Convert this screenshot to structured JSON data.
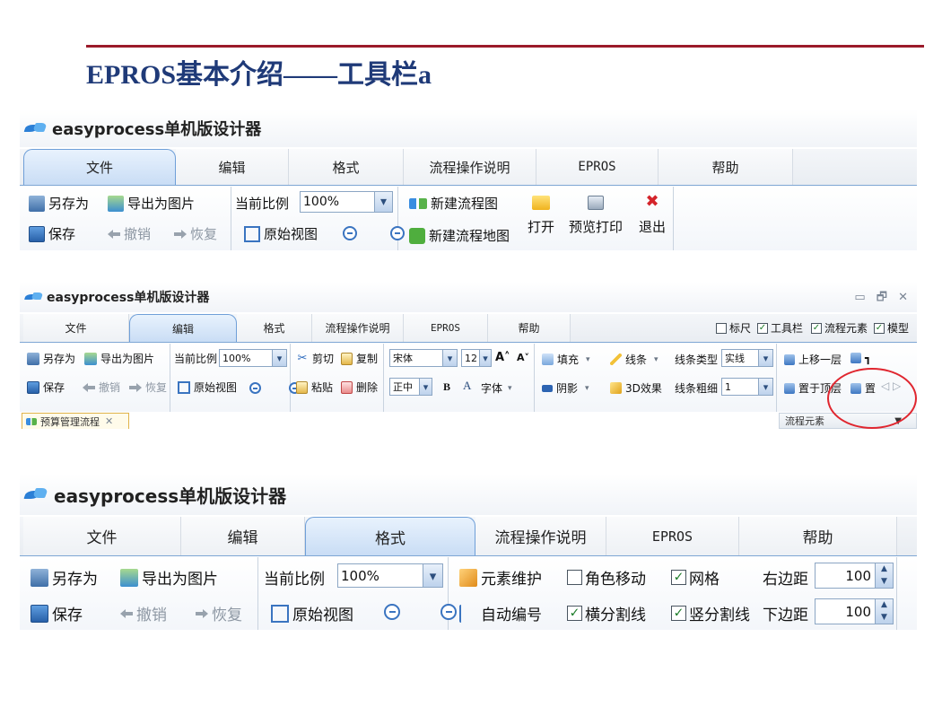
{
  "slide": {
    "title": "EPROS基本介绍——工具栏a",
    "accent_color": "#9b1b2a",
    "title_color": "#1f3a78"
  },
  "window": {
    "title": "easyprocess单机版设计器",
    "logo_icon": "easyprocess-logo-icon"
  },
  "tabs": [
    "文件",
    "编辑",
    "格式",
    "流程操作说明",
    "EPROS",
    "帮助"
  ],
  "file_ribbon": {
    "save_as": "另存为",
    "export_image": "导出为图片",
    "save": "保存",
    "undo": "撤销",
    "redo": "恢复",
    "zoom_label": "当前比例",
    "zoom_value": "100%",
    "original_view": "原始视图",
    "new_flow": "新建流程图",
    "new_flow_map": "新建流程地图",
    "open": "打开",
    "print_preview": "预览打印",
    "exit": "退出"
  },
  "edit_ribbon": {
    "window_controls": "▭ 🗗 ✕",
    "toggles": [
      {
        "label": "标尺",
        "checked": false
      },
      {
        "label": "工具栏",
        "checked": true
      },
      {
        "label": "流程元素",
        "checked": true
      },
      {
        "label": "模型",
        "checked": true
      }
    ],
    "save_as": "另存为",
    "export_image": "导出为图片",
    "save": "保存",
    "undo": "撤销",
    "redo": "恢复",
    "zoom_label": "当前比例",
    "zoom_value": "100%",
    "original_view": "原始视图",
    "cut": "剪切",
    "copy": "复制",
    "paste": "粘贴",
    "delete": "删除",
    "font_name": "宋体",
    "font_size": "12",
    "grow_font": "A˄",
    "shrink_font": "A˅",
    "align": "正中",
    "bold": "B",
    "font_color_glyph": "A",
    "font": "字体",
    "fill": "填充",
    "line": "线条",
    "line_type_label": "线条类型",
    "line_type_value": "实线",
    "shadow": "阴影",
    "effect_3d": "3D效果",
    "line_width_label": "线条粗细",
    "line_width_value": "1",
    "move_up": "上移一层",
    "move_up_truncated": "┓",
    "bring_to_front": "置于顶层",
    "bring_truncated": "置",
    "document_tab": "预算管理流程",
    "pane_title": "流程元素",
    "scroll_arrows": "◁ ▷"
  },
  "format_ribbon": {
    "save_as": "另存为",
    "export_image": "导出为图片",
    "save": "保存",
    "undo": "撤销",
    "redo": "恢复",
    "zoom_label": "当前比例",
    "zoom_value": "100%",
    "original_view": "原始视图",
    "element_maintenance": "元素维护",
    "role_move": {
      "label": "角色移动",
      "checked": false
    },
    "grid": {
      "label": "网格",
      "checked": true
    },
    "auto_number": "自动编号",
    "horizontal_divider": {
      "label": "横分割线",
      "checked": true
    },
    "vertical_divider": {
      "label": "竖分割线",
      "checked": true
    },
    "right_margin_label": "右边距",
    "right_margin_value": "100",
    "bottom_margin_label": "下边距",
    "bottom_margin_value": "100"
  }
}
